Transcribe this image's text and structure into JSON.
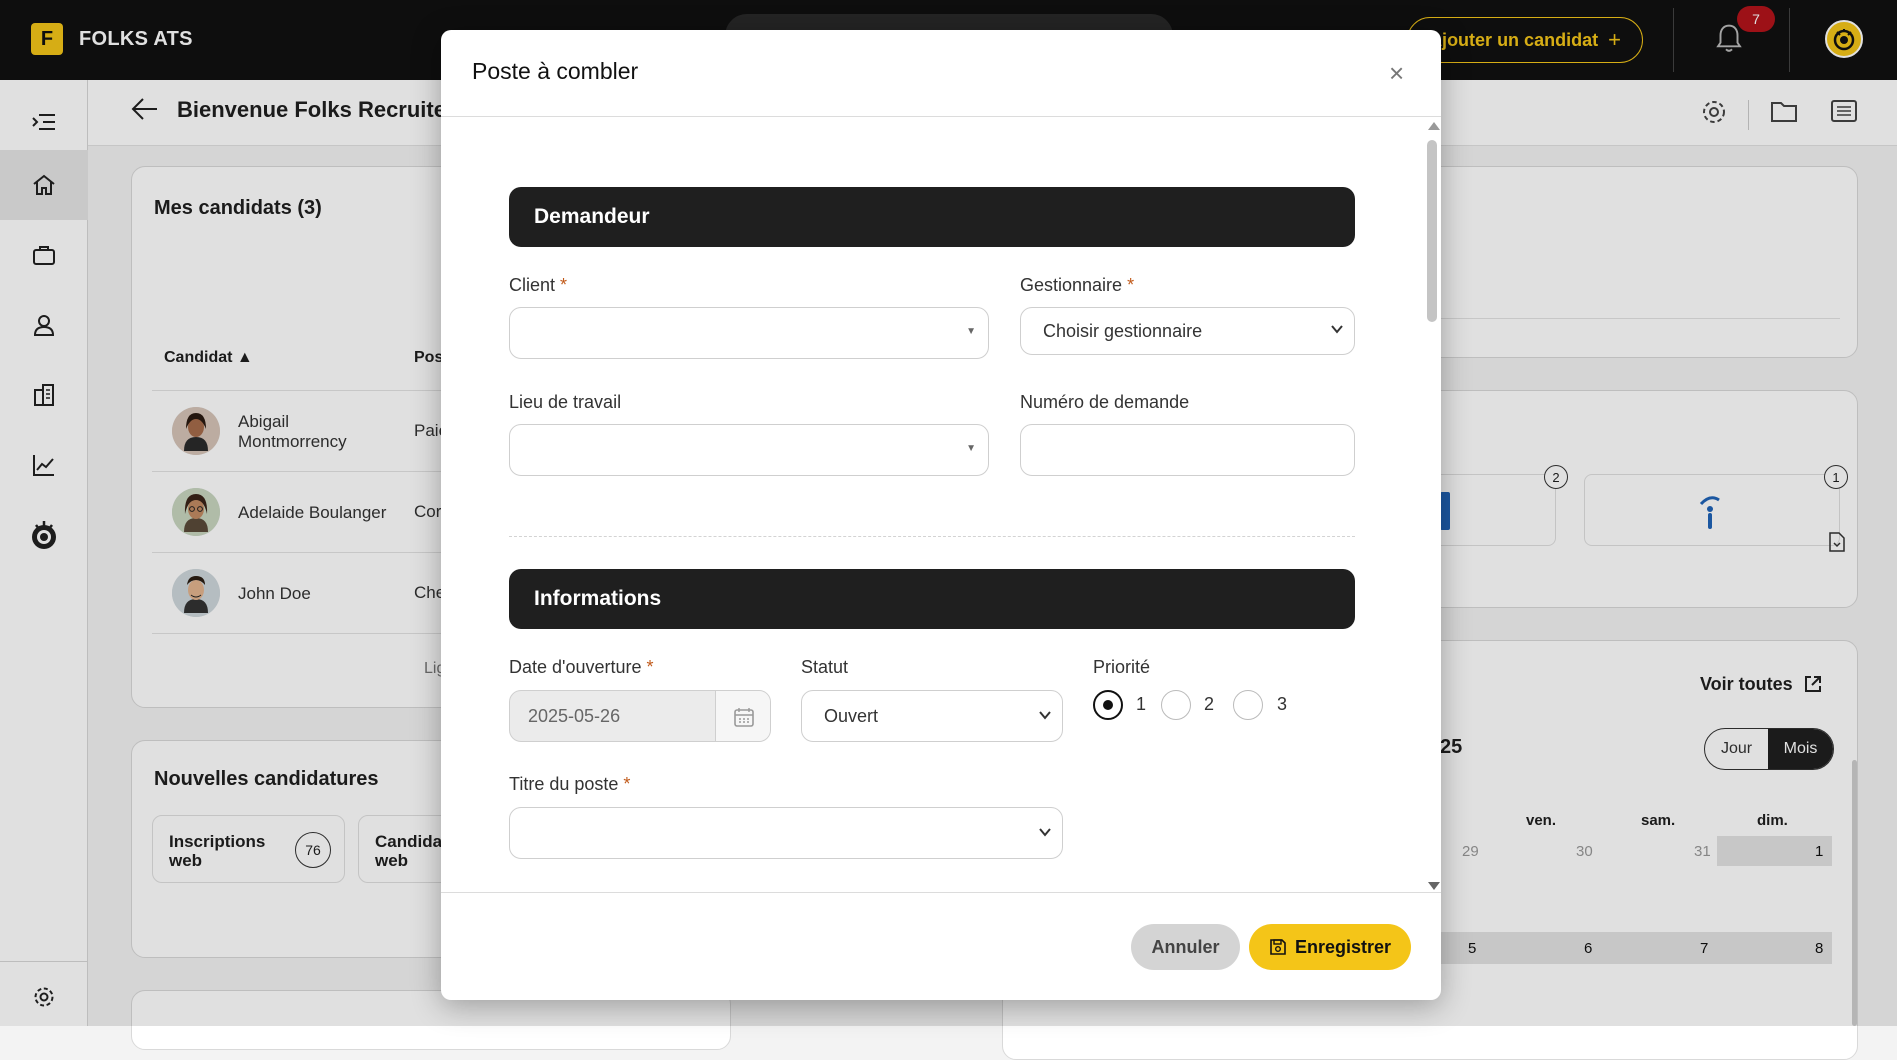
{
  "topbar": {
    "logo_letter": "F",
    "brand": "FOLKS ATS",
    "add_candidate": "Ajouter un candidat",
    "notifications_count": "7"
  },
  "sidebar": {
    "items": [
      "menu-toggle",
      "home",
      "jobs",
      "candidates",
      "clients",
      "reports",
      "brand"
    ]
  },
  "header": {
    "welcome": "Bienvenue Folks Recruite"
  },
  "candidates_card": {
    "title": "Mes candidats (3)",
    "col_candidate": "Candidat ▲",
    "col_position": "Pos",
    "rows": [
      {
        "name_line1": "Abigail",
        "name_line2": "Montmorrency",
        "position": "Paie"
      },
      {
        "name": "Adelaide Boulanger",
        "position": "Cor"
      },
      {
        "name": "John Doe",
        "position": "Che"
      }
    ],
    "footer_link": "Lig"
  },
  "applications_card": {
    "title": "Nouvelles candidatures",
    "items": [
      {
        "label_line1": "Inscriptions",
        "label_line2": "web",
        "count": "76"
      },
      {
        "label_line1": "Candidat",
        "label_line2": "web"
      }
    ]
  },
  "right_panels": {
    "count_a": "2",
    "count_b": "1",
    "see_all": "Voir toutes",
    "year_fragment": "25",
    "view_day": "Jour",
    "view_month": "Mois",
    "days": [
      "ven.",
      "sam.",
      "dim."
    ],
    "week1": [
      "29",
      "30",
      "31",
      "1"
    ],
    "week2": [
      "5",
      "6",
      "7",
      "8"
    ]
  },
  "modal": {
    "title": "Poste à combler",
    "close": "×",
    "section_requester": "Demandeur",
    "client_label": "Client",
    "manager_label": "Gestionnaire",
    "manager_value": "Choisir gestionnaire",
    "workplace_label": "Lieu de travail",
    "request_number_label": "Numéro de demande",
    "section_info": "Informations",
    "opening_date_label": "Date d'ouverture",
    "opening_date_value": "2025-05-26",
    "status_label": "Statut",
    "status_value": "Ouvert",
    "priority_label": "Priorité",
    "priority_options": [
      "1",
      "2",
      "3"
    ],
    "priority_selected": "1",
    "job_title_label": "Titre du poste",
    "required_mark": "*",
    "cancel": "Annuler",
    "save": "Enregistrer"
  },
  "colors": {
    "accent": "#f4c518",
    "dark": "#1f1f1f",
    "badge": "#b3141b"
  }
}
